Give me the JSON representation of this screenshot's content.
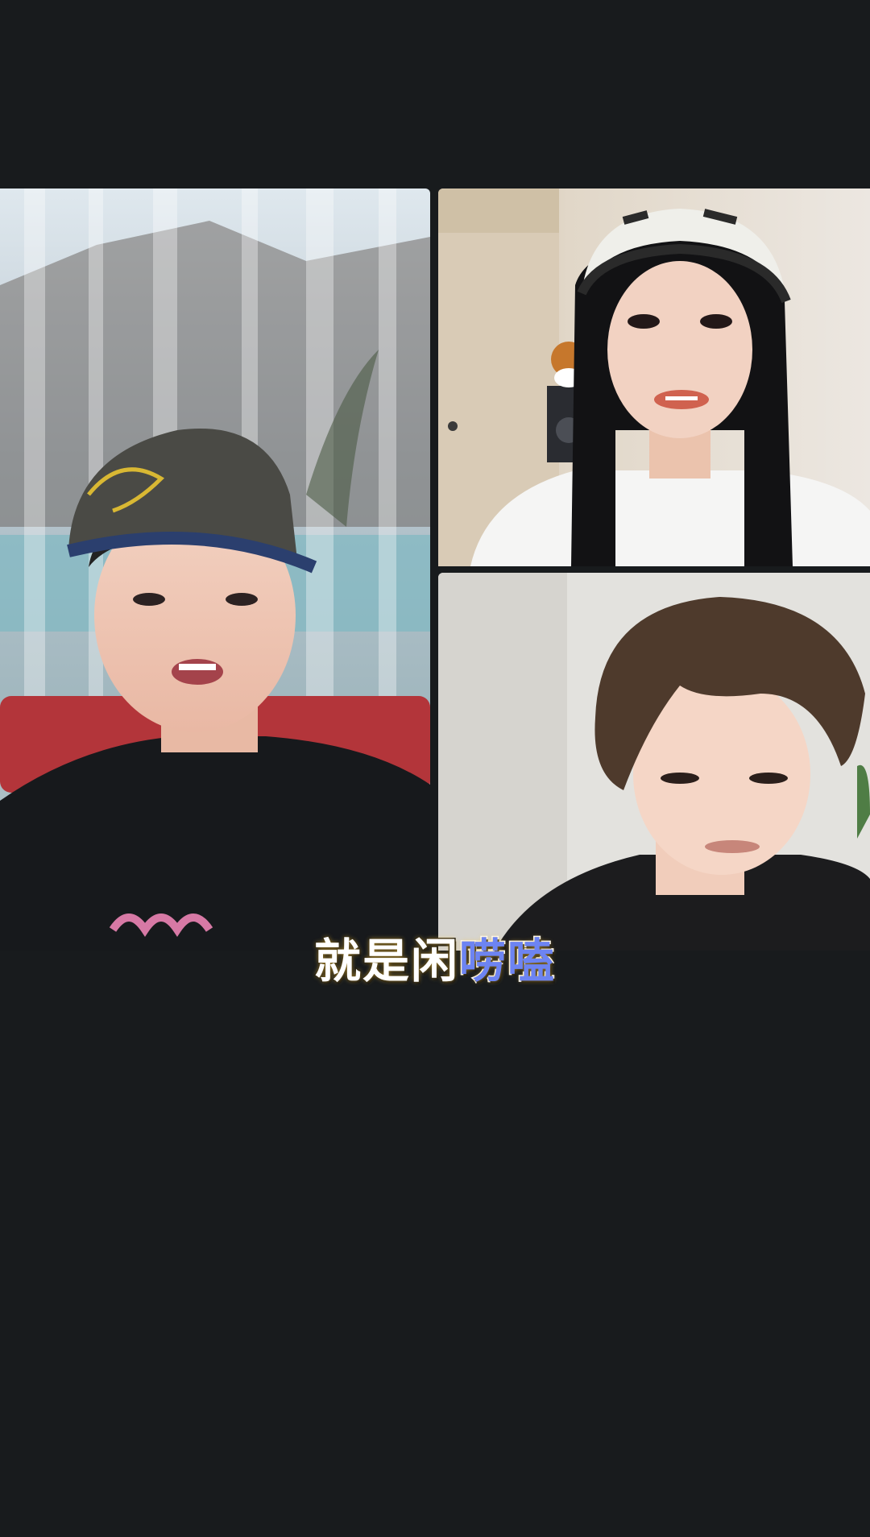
{
  "participants": [
    {
      "slot": "left-large"
    },
    {
      "slot": "top-right"
    },
    {
      "slot": "bottom-right"
    }
  ],
  "subtitle": {
    "part1": "就是闲",
    "part2": "唠嗑"
  },
  "colors": {
    "background": "#181b1d",
    "subtitle_white": "#ffffff",
    "subtitle_highlight": "#6d84f2"
  }
}
